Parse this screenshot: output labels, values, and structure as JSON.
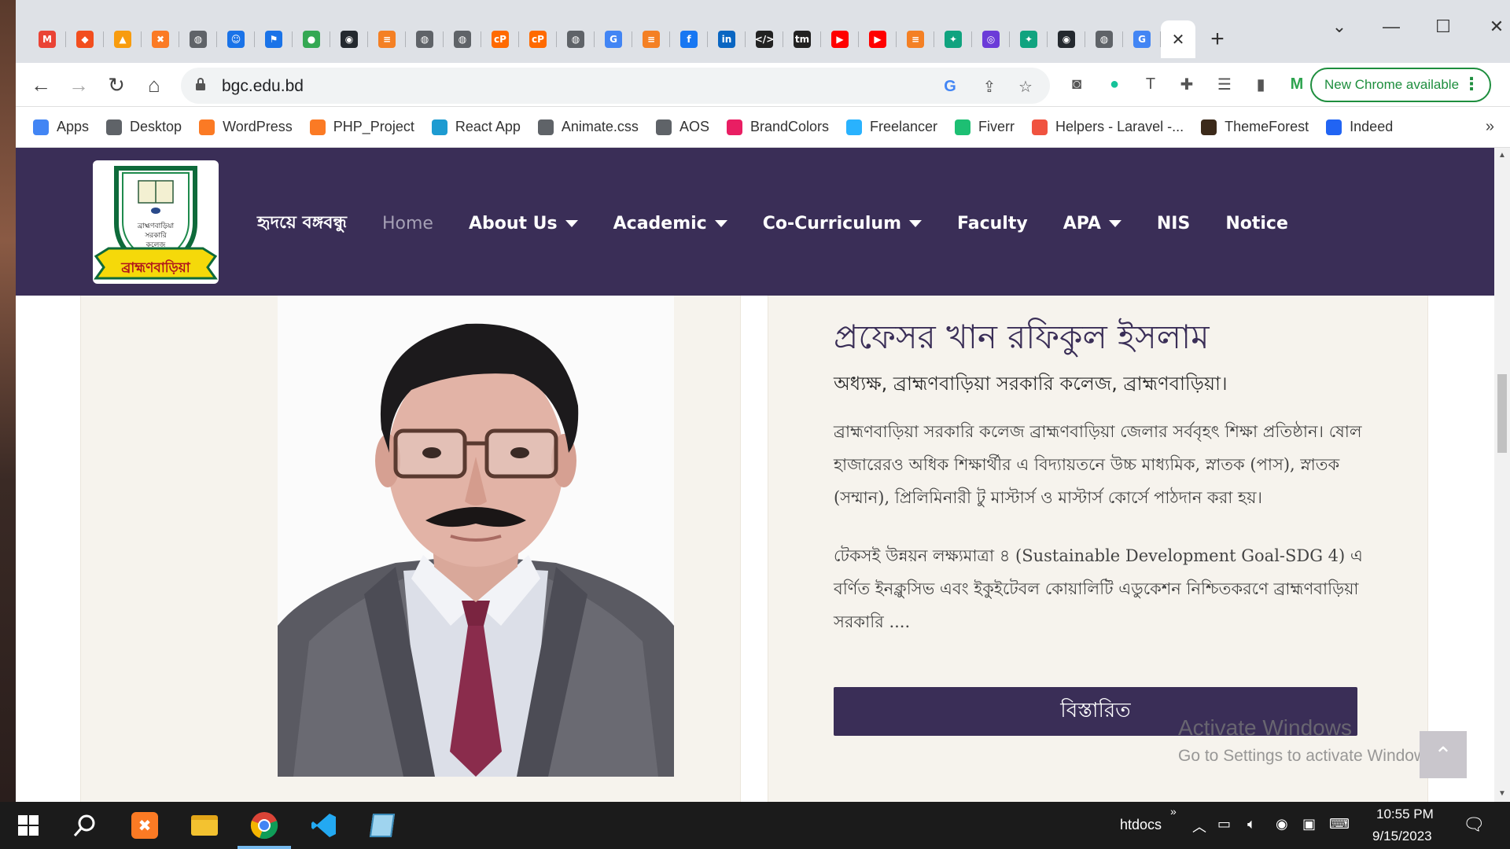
{
  "browser": {
    "tabs": [
      {
        "icon": "gmail-icon",
        "color": "#ea4335",
        "glyph": "M"
      },
      {
        "icon": "figma-icon",
        "color": "#f24e1e",
        "glyph": "◆"
      },
      {
        "icon": "pma-icon",
        "color": "#f89c0e",
        "glyph": "▲"
      },
      {
        "icon": "xampp-icon",
        "color": "#fb7a24",
        "glyph": "✖"
      },
      {
        "icon": "globe-icon",
        "color": "#5f6368",
        "glyph": "◍"
      },
      {
        "icon": "smiley-icon",
        "color": "#1a73e8",
        "glyph": "☺"
      },
      {
        "icon": "flag-icon",
        "color": "#1a73e8",
        "glyph": "⚑"
      },
      {
        "icon": "leaf-icon",
        "color": "#34a853",
        "glyph": "●"
      },
      {
        "icon": "github-icon",
        "color": "#24292f",
        "glyph": "◉"
      },
      {
        "icon": "stackoverflow-icon",
        "color": "#f48024",
        "glyph": "≡"
      },
      {
        "icon": "globe-icon",
        "color": "#5f6368",
        "glyph": "◍"
      },
      {
        "icon": "globe-icon",
        "color": "#5f6368",
        "glyph": "◍"
      },
      {
        "icon": "cp-icon",
        "color": "#ff6a00",
        "glyph": "cP"
      },
      {
        "icon": "cp-icon",
        "color": "#ff6a00",
        "glyph": "cP"
      },
      {
        "icon": "globe-icon",
        "color": "#5f6368",
        "glyph": "◍"
      },
      {
        "icon": "translate-icon",
        "color": "#4285f4",
        "glyph": "G"
      },
      {
        "icon": "stackoverflow-icon",
        "color": "#f48024",
        "glyph": "≡"
      },
      {
        "icon": "facebook-icon",
        "color": "#1877f2",
        "glyph": "f"
      },
      {
        "icon": "linkedin-icon",
        "color": "#0a66c2",
        "glyph": "in"
      },
      {
        "icon": "dev-icon",
        "color": "#222",
        "glyph": "</>"
      },
      {
        "icon": "tm-icon",
        "color": "#222",
        "glyph": "tm"
      },
      {
        "icon": "youtube-icon",
        "color": "#ff0000",
        "glyph": "▶"
      },
      {
        "icon": "youtube-icon",
        "color": "#ff0000",
        "glyph": "▶"
      },
      {
        "icon": "stackoverflow-icon",
        "color": "#f48024",
        "glyph": "≡"
      },
      {
        "icon": "chatgpt-icon",
        "color": "#10a37f",
        "glyph": "✦"
      },
      {
        "icon": "extension-icon",
        "color": "#6b3bd8",
        "glyph": "◎"
      },
      {
        "icon": "chatgpt-icon",
        "color": "#10a37f",
        "glyph": "✦"
      },
      {
        "icon": "github-icon",
        "color": "#24292f",
        "glyph": "◉"
      },
      {
        "icon": "globe-icon",
        "color": "#5f6368",
        "glyph": "◍"
      },
      {
        "icon": "google-icon",
        "color": "#4285f4",
        "glyph": "G"
      }
    ],
    "url": "bgc.edu.bd",
    "update_button": "New Chrome available",
    "bookmarks": [
      {
        "label": "Apps",
        "icon": "apps-grid-icon",
        "color": "#4285f4"
      },
      {
        "label": "Desktop",
        "icon": "globe-icon",
        "color": "#5f6368"
      },
      {
        "label": "WordPress",
        "icon": "xampp-icon",
        "color": "#fb7a24"
      },
      {
        "label": "PHP_Project",
        "icon": "xampp-icon",
        "color": "#fb7a24"
      },
      {
        "label": "React App",
        "icon": "react-icon",
        "color": "#1d9bd1"
      },
      {
        "label": "Animate.css",
        "icon": "globe-icon",
        "color": "#5f6368"
      },
      {
        "label": "AOS",
        "icon": "globe-icon",
        "color": "#5f6368"
      },
      {
        "label": "BrandColors",
        "icon": "brandcolors-icon",
        "color": "#e91e63"
      },
      {
        "label": "Freelancer",
        "icon": "freelancer-icon",
        "color": "#29b2fe"
      },
      {
        "label": "Fiverr",
        "icon": "fiverr-icon",
        "color": "#1dbf73"
      },
      {
        "label": "Helpers - Laravel -...",
        "icon": "laravel-icon",
        "color": "#f05340"
      },
      {
        "label": "ThemeForest",
        "icon": "themeforest-icon",
        "color": "#3c2a1a"
      },
      {
        "label": "Indeed",
        "icon": "indeed-icon",
        "color": "#2164f3"
      }
    ]
  },
  "site": {
    "logo_caption": "ব্রাহ্মণবাড়িয়া",
    "logo_lines": [
      "ব্রাহ্মণবাড়িয়া",
      "সরকারি",
      "কলেজ"
    ],
    "nav": [
      {
        "label": "হৃদয়ে বঙ্গবন্ধু",
        "dropdown": false,
        "active": false
      },
      {
        "label": "Home",
        "dropdown": false,
        "active": true
      },
      {
        "label": "About Us",
        "dropdown": true,
        "active": false
      },
      {
        "label": "Academic",
        "dropdown": true,
        "active": false
      },
      {
        "label": "Co-Curriculum",
        "dropdown": true,
        "active": false
      },
      {
        "label": "Faculty",
        "dropdown": false,
        "active": false
      },
      {
        "label": "APA",
        "dropdown": true,
        "active": false
      },
      {
        "label": "NIS",
        "dropdown": false,
        "active": false
      },
      {
        "label": "Notice",
        "dropdown": false,
        "active": false
      }
    ],
    "principal": {
      "name": "প্রফেসর খান রফিকুল ইসলাম",
      "title": "অধ্যক্ষ, ব্রাহ্মণবাড়িয়া সরকারি কলেজ, ব্রাহ্মণবাড়িয়া।",
      "para1": "ব্রাহ্মণবাড়িয়া সরকারি কলেজ ব্রাহ্মণবাড়িয়া জেলার সর্ববৃহৎ শিক্ষা প্রতিষ্ঠান। ষোল হাজারেরও অধিক শিক্ষার্থীর এ বিদ্যায়তনে উচ্চ মাধ্যমিক, স্নাতক (পাস), স্নাতক (সম্মান), প্রিলিমিনারী টু মাস্টার্স ও মাস্টার্স কোর্সে পাঠদান করা হয়।",
      "para2": "টেকসই উন্নয়ন লক্ষ্যমাত্রা ৪ (Sustainable Development Goal-SDG 4) এ বর্ণিত ইনক্লুসিভ এবং ইকুইটেবল কোয়ালিটি এডুকেশন নিশ্চিতকরণে ব্রাহ্মণবাড়িয়া সরকারি  ....",
      "button": "বিস্তারিত"
    },
    "watermark": {
      "line1": "Activate Windows",
      "line2": "Go to Settings to activate Windows."
    }
  },
  "taskbar": {
    "folder_label": "htdocs",
    "time": "10:55 PM",
    "date": "9/15/2023"
  },
  "colors": {
    "site_primary": "#3a2e57",
    "card_bg": "#f6f3ed",
    "chrome_update": "#1e8e3e"
  }
}
